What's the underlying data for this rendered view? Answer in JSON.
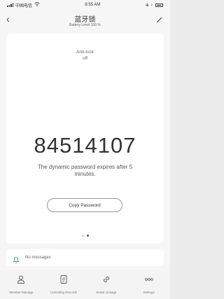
{
  "status_bar": {
    "carrier": "中国电信",
    "time": "8:55 AM",
    "battery_label": "⊕ ♀"
  },
  "header": {
    "title": "蓝牙锁",
    "subtitle": "Battery Level:100 %"
  },
  "status": {
    "label": "Anti-lock",
    "value": "off"
  },
  "password": {
    "code": "84514107",
    "expire_text": "The dynamic password expires after 5 minutes.",
    "copy_label": "Copy Password"
  },
  "pager": {
    "count": 2,
    "active_index": 1
  },
  "messages": {
    "text": "No messages"
  },
  "tabs": [
    {
      "label": "Member Manage",
      "icon": "person-icon"
    },
    {
      "label": "Unlocking Records",
      "icon": "document-icon"
    },
    {
      "label": "Smart Linkage",
      "icon": "link-icon"
    },
    {
      "label": "Settings",
      "icon": "more-icon"
    }
  ]
}
